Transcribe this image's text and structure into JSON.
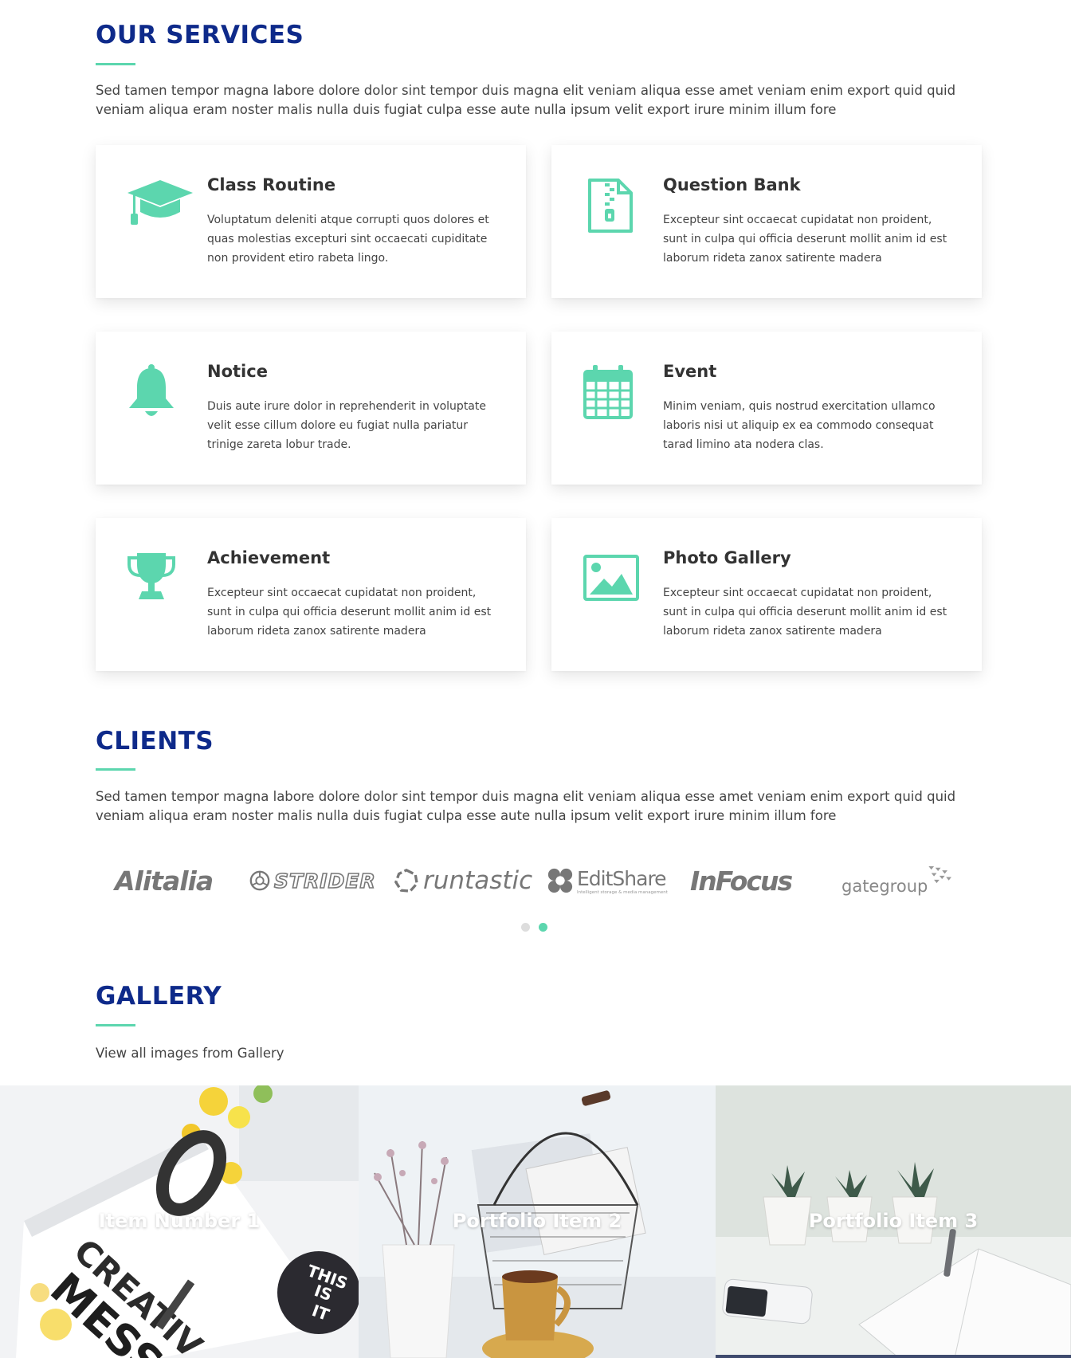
{
  "services": {
    "title": "OUR SERVICES",
    "intro": "Sed tamen tempor magna labore dolore dolor sint tempor duis magna elit veniam aliqua esse amet veniam enim export quid quid veniam aliqua eram noster malis nulla duis fugiat culpa esse aute nulla ipsum velit export irure minim illum fore",
    "accent_color": "#5cd6ae",
    "title_color": "#0e2a8a",
    "items": [
      {
        "icon": "graduation-cap-icon",
        "title": "Class Routine",
        "desc": "Voluptatum deleniti atque corrupti quos dolores et quas molestias excepturi sint occaecati cupiditate non provident etiro rabeta lingo."
      },
      {
        "icon": "zip-file-icon",
        "title": "Question Bank",
        "desc": "Excepteur sint occaecat cupidatat non proident, sunt in culpa qui officia deserunt mollit anim id est laborum rideta zanox satirente madera"
      },
      {
        "icon": "bell-icon",
        "title": "Notice",
        "desc": "Duis aute irure dolor in reprehenderit in voluptate velit esse cillum dolore eu fugiat nulla pariatur trinige zareta lobur trade."
      },
      {
        "icon": "calendar-icon",
        "title": "Event",
        "desc": "Minim veniam, quis nostrud exercitation ullamco laboris nisi ut aliquip ex ea commodo consequat tarad limino ata nodera clas."
      },
      {
        "icon": "trophy-icon",
        "title": "Achievement",
        "desc": "Excepteur sint occaecat cupidatat non proident, sunt in culpa qui officia deserunt mollit anim id est laborum rideta zanox satirente madera"
      },
      {
        "icon": "image-icon",
        "title": "Photo Gallery",
        "desc": "Excepteur sint occaecat cupidatat non proident, sunt in culpa qui officia deserunt mollit anim id est laborum rideta zanox satirente madera"
      }
    ]
  },
  "clients": {
    "title": "CLIENTS",
    "intro": "Sed tamen tempor magna labore dolore dolor sint tempor duis magna elit veniam aliqua esse amet veniam enim export quid quid veniam aliqua eram noster malis nulla duis fugiat culpa esse aute nulla ipsum velit export irure minim illum fore",
    "logos": [
      "Alitalia",
      "STRIDER",
      "runtastic",
      "EditShare",
      "InFocus",
      "gategroup"
    ],
    "editshare_tagline": "Intelligent storage & media management",
    "slider": {
      "pages": 2,
      "active": 2,
      "active_color": "#5cd6ae",
      "inactive_color": "#dddddd"
    }
  },
  "gallery": {
    "title": "GALLERY",
    "subtitle": "View all images from Gallery",
    "items": [
      {
        "caption": "Item Number 1",
        "photo_text": [
          "CREATIV",
          "MESS",
          "THIS",
          "IS",
          "IT"
        ]
      },
      {
        "caption": "Portfolio Item 2"
      },
      {
        "caption": "Portfolio Item 3"
      }
    ]
  }
}
